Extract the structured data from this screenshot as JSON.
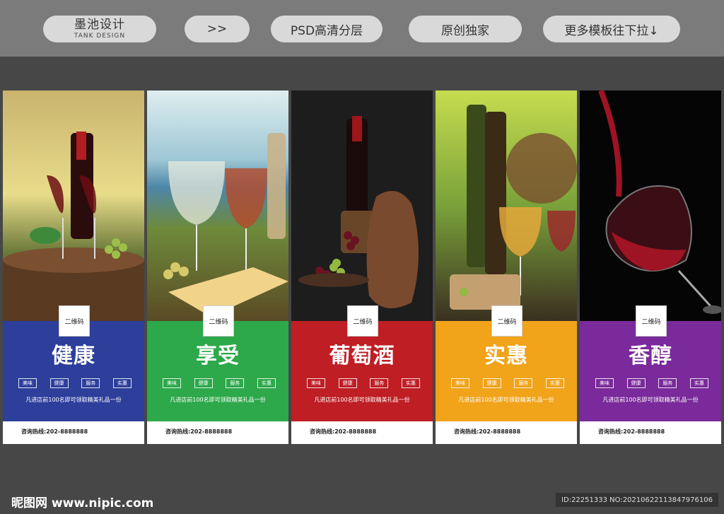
{
  "header": {
    "brand_title": "墨池设计",
    "brand_subtitle": "TANK DESIGN",
    "arrow": ">>",
    "psd": "PSD高清分层",
    "original": "原创独家",
    "more": "更多模板往下拉↓"
  },
  "cards": [
    {
      "qr_label": "二维码",
      "title": "健康",
      "tags": [
        "美味",
        "健康",
        "服务",
        "实惠"
      ],
      "note": "凡进店前100名即可领取精美礼品一份",
      "hotline": "咨询热线:202-8888888",
      "band_color": "#2d3f9b"
    },
    {
      "qr_label": "二维码",
      "title": "享受",
      "tags": [
        "美味",
        "健康",
        "服务",
        "实惠"
      ],
      "note": "凡进店前100名即可领取精美礼品一份",
      "hotline": "咨询热线:202-8888888",
      "band_color": "#2da84a"
    },
    {
      "qr_label": "二维码",
      "title": "葡萄酒",
      "tags": [
        "美味",
        "健康",
        "服务",
        "实惠"
      ],
      "note": "凡进店前100名即可领取精美礼品一份",
      "hotline": "咨询热线:202-8888888",
      "band_color": "#be1e24"
    },
    {
      "qr_label": "二维码",
      "title": "实惠",
      "tags": [
        "美味",
        "健康",
        "服务",
        "实惠"
      ],
      "note": "凡进店前100名即可领取精美礼品一份",
      "hotline": "咨询热线:202-8888888",
      "band_color": "#f1a31a"
    },
    {
      "qr_label": "二维码",
      "title": "香醇",
      "tags": [
        "美味",
        "健康",
        "服务",
        "实惠"
      ],
      "note": "凡进店前100名即可领取精美礼品一份",
      "hotline": "咨询热线:202-8888888",
      "band_color": "#7a2a9a"
    }
  ],
  "footer": {
    "site": "昵图网 www.nipic.com",
    "id": "ID:22251333 NO:20210622113847976106"
  }
}
